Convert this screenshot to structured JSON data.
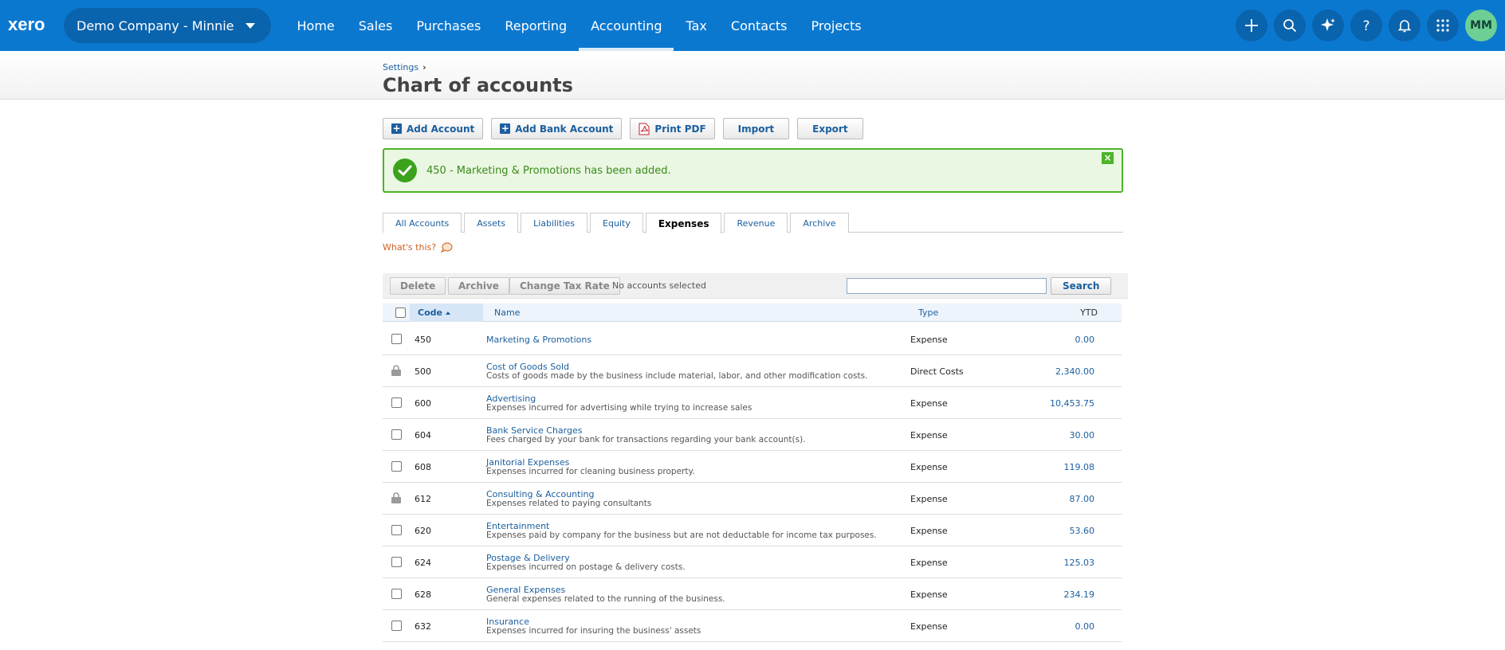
{
  "nav": {
    "logo": "xero",
    "org_name": "Demo Company - Minnie",
    "links": [
      "Home",
      "Sales",
      "Purchases",
      "Reporting",
      "Accounting",
      "Tax",
      "Contacts",
      "Projects"
    ],
    "active_link": "Accounting",
    "icons": [
      "plus-icon",
      "search-icon",
      "sparkle-icon",
      "help-icon",
      "bell-icon",
      "apps-grid-icon"
    ],
    "avatar_initials": "MM",
    "colors": {
      "bar": "#0b78d0",
      "pill": "#0a63ad",
      "avatar": "#6dcf94"
    }
  },
  "header": {
    "breadcrumb": "Settings",
    "title": "Chart of accounts"
  },
  "toolbar": {
    "add_account": "Add Account",
    "add_bank_account": "Add Bank Account",
    "print_pdf": "Print PDF",
    "import": "Import",
    "export": "Export"
  },
  "notice": {
    "message": "450 - Marketing & Promotions has been added.",
    "close": "×",
    "color": "#4cb32a"
  },
  "tabs": {
    "items": [
      "All Accounts",
      "Assets",
      "Liabilities",
      "Equity",
      "Expenses",
      "Revenue",
      "Archive"
    ],
    "active": "Expenses"
  },
  "help": {
    "whats_this": "What's this?"
  },
  "actions": {
    "delete": "Delete",
    "archive": "Archive",
    "change_tax_rate": "Change Tax Rate",
    "selection_status": "No accounts selected",
    "search_value": "",
    "search_button": "Search"
  },
  "table": {
    "columns": {
      "code": "Code",
      "name": "Name",
      "type": "Type",
      "ytd": "YTD"
    },
    "rows": [
      {
        "code": "450",
        "name": "Marketing & Promotions",
        "description": "",
        "type": "Expense",
        "ytd": "0.00",
        "locked": false
      },
      {
        "code": "500",
        "name": "Cost of Goods Sold",
        "description": "Costs of goods made by the business include material, labor, and other modification costs.",
        "type": "Direct Costs",
        "ytd": "2,340.00",
        "locked": true
      },
      {
        "code": "600",
        "name": "Advertising",
        "description": "Expenses incurred for advertising while trying to increase sales",
        "type": "Expense",
        "ytd": "10,453.75",
        "locked": false
      },
      {
        "code": "604",
        "name": "Bank Service Charges",
        "description": "Fees charged by your bank for transactions regarding your bank account(s).",
        "type": "Expense",
        "ytd": "30.00",
        "locked": false
      },
      {
        "code": "608",
        "name": "Janitorial Expenses",
        "description": "Expenses incurred for cleaning business property.",
        "type": "Expense",
        "ytd": "119.08",
        "locked": false
      },
      {
        "code": "612",
        "name": "Consulting & Accounting",
        "description": "Expenses related to paying consultants",
        "type": "Expense",
        "ytd": "87.00",
        "locked": true
      },
      {
        "code": "620",
        "name": "Entertainment",
        "description": "Expenses paid by company for the business but are not deductable for income tax purposes.",
        "type": "Expense",
        "ytd": "53.60",
        "locked": false
      },
      {
        "code": "624",
        "name": "Postage & Delivery",
        "description": "Expenses incurred on postage & delivery costs.",
        "type": "Expense",
        "ytd": "125.03",
        "locked": false
      },
      {
        "code": "628",
        "name": "General Expenses",
        "description": "General expenses related to the running of the business.",
        "type": "Expense",
        "ytd": "234.19",
        "locked": false
      },
      {
        "code": "632",
        "name": "Insurance",
        "description": "Expenses incurred for insuring the business' assets",
        "type": "Expense",
        "ytd": "0.00",
        "locked": false
      }
    ]
  }
}
